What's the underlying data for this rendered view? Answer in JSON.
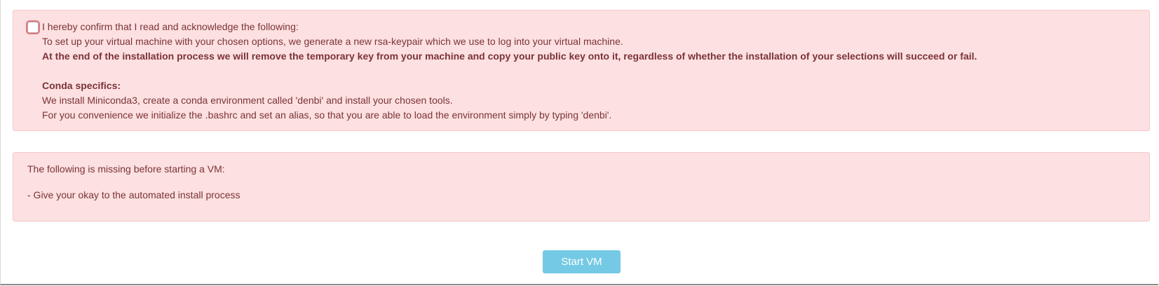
{
  "acknowledgement": {
    "checkbox_checked": false,
    "confirm_label": "I hereby confirm that I read and acknowledge the following:",
    "line1": "To set up your virtual machine with your chosen options, we generate a new rsa-keypair which we use to log into your virtual machine.",
    "line2": "At the end of the installation process we will remove the temporary key from your machine and copy your public key onto it, regardless of whether the installation of your selections will succeed or fail.",
    "conda_heading": "Conda specifics:",
    "conda_line1": "We install Miniconda3, create a conda environment called 'denbi' and install your chosen tools.",
    "conda_line2": "For you convenience we initialize the .bashrc and set an alias, so that you are able to load the environment simply by typing 'denbi'."
  },
  "missing": {
    "title": "The following is missing before starting a VM:",
    "items": [
      "- Give your okay to the automated install process"
    ]
  },
  "actions": {
    "start_label": "Start VM"
  },
  "colors": {
    "alert_bg": "#fde0e1",
    "alert_text": "#7a3338",
    "button_bg": "#74c9e5"
  }
}
